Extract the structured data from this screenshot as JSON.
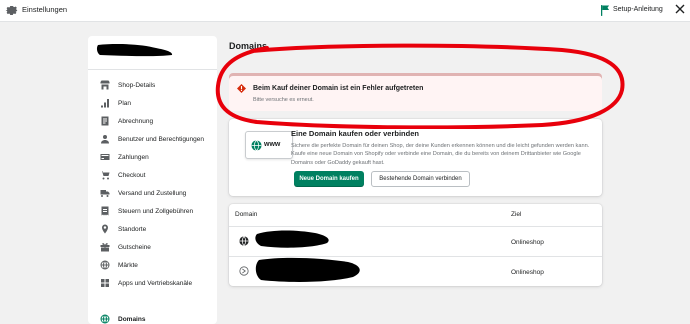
{
  "topbar": {
    "title": "Einstellungen",
    "setup_label": "Setup-Anleitung",
    "icons": [
      "gear-icon",
      "flag-icon",
      "close-icon"
    ]
  },
  "sidebar": {
    "items": [
      {
        "label": "Shop-Details",
        "icon": "store-icon",
        "active": false
      },
      {
        "label": "Plan",
        "icon": "plan-icon",
        "active": false
      },
      {
        "label": "Abrechnung",
        "icon": "billing-icon",
        "active": false
      },
      {
        "label": "Benutzer und Berechtigungen",
        "icon": "user-icon",
        "active": false
      },
      {
        "label": "Zahlungen",
        "icon": "payments-icon",
        "active": false
      },
      {
        "label": "Checkout",
        "icon": "cart-icon",
        "active": false
      },
      {
        "label": "Versand und Zustellung",
        "icon": "truck-icon",
        "active": false
      },
      {
        "label": "Steuern und Zollgebühren",
        "icon": "taxes-icon",
        "active": false
      },
      {
        "label": "Standorte",
        "icon": "location-icon",
        "active": false
      },
      {
        "label": "Gutscheine",
        "icon": "gift-card-icon",
        "active": false
      },
      {
        "label": "Märkte",
        "icon": "globe-icon",
        "active": false
      },
      {
        "label": "Apps und Vertriebskanäle",
        "icon": "apps-icon",
        "active": false
      },
      {
        "label": "Domains",
        "icon": "globe-icon",
        "active": true
      }
    ]
  },
  "main": {
    "title": "Domains",
    "error_banner": {
      "title": "Beim Kauf deiner Domain ist ein Fehler aufgetreten",
      "text": "Bitte versuche es erneut."
    },
    "buy_card": {
      "illustration_text": "www",
      "heading": "Eine Domain kaufen oder verbinden",
      "description": "Sichere die perfekte Domain für deinen Shop, der deine Kunden erkennen können und die leicht gefunden werden kann. Kaufe eine neue Domain von Shopify oder verbinde eine Domain, die du bereits von deinem Drittanbieter wie Google Domains oder GoDaddy gekauft hast.",
      "primary_button": "Neue Domain kaufen",
      "secondary_button": "Bestehende Domain verbinden"
    },
    "domains_table": {
      "columns": [
        "Domain",
        "Ziel"
      ],
      "rows": [
        {
          "ziel": "Onlineshop",
          "icon": "globe-icon"
        },
        {
          "ziel": "Onlineshop",
          "icon": "redirect-icon"
        }
      ]
    }
  },
  "colors": {
    "accent": "#008060",
    "critical": "#d72c0d",
    "annotation": "#e8000b",
    "redaction": "#000000"
  }
}
